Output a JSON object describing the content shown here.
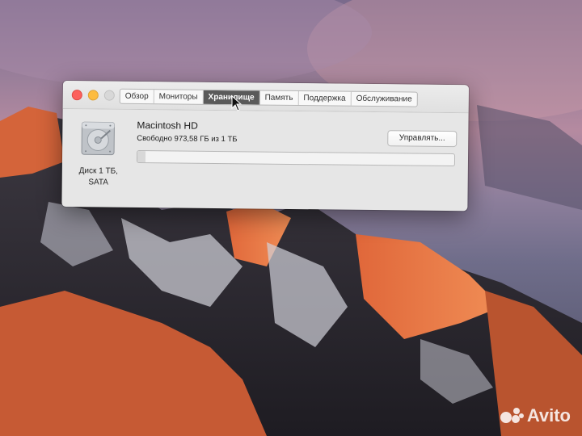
{
  "window": {
    "tabs": [
      {
        "label": "Обзор",
        "active": false
      },
      {
        "label": "Мониторы",
        "active": false
      },
      {
        "label": "Хранилище",
        "active": true
      },
      {
        "label": "Память",
        "active": false
      },
      {
        "label": "Поддержка",
        "active": false
      },
      {
        "label": "Обслуживание",
        "active": false
      }
    ],
    "disk": {
      "name": "Macintosh HD",
      "free_text": "Свободно 973,58 ГБ из 1 ТБ",
      "caption_line1": "Диск 1 ТБ,",
      "caption_line2": "SATA",
      "used_fraction": 0.026,
      "icon": "hard-drive-icon"
    },
    "manage_label": "Управлять..."
  },
  "watermark": {
    "text": "Avito"
  },
  "colors": {
    "close": "#fc605c",
    "minimize": "#fdbc40",
    "maximize": "#d8d8d8",
    "active_tab": "#5a5a5a"
  }
}
